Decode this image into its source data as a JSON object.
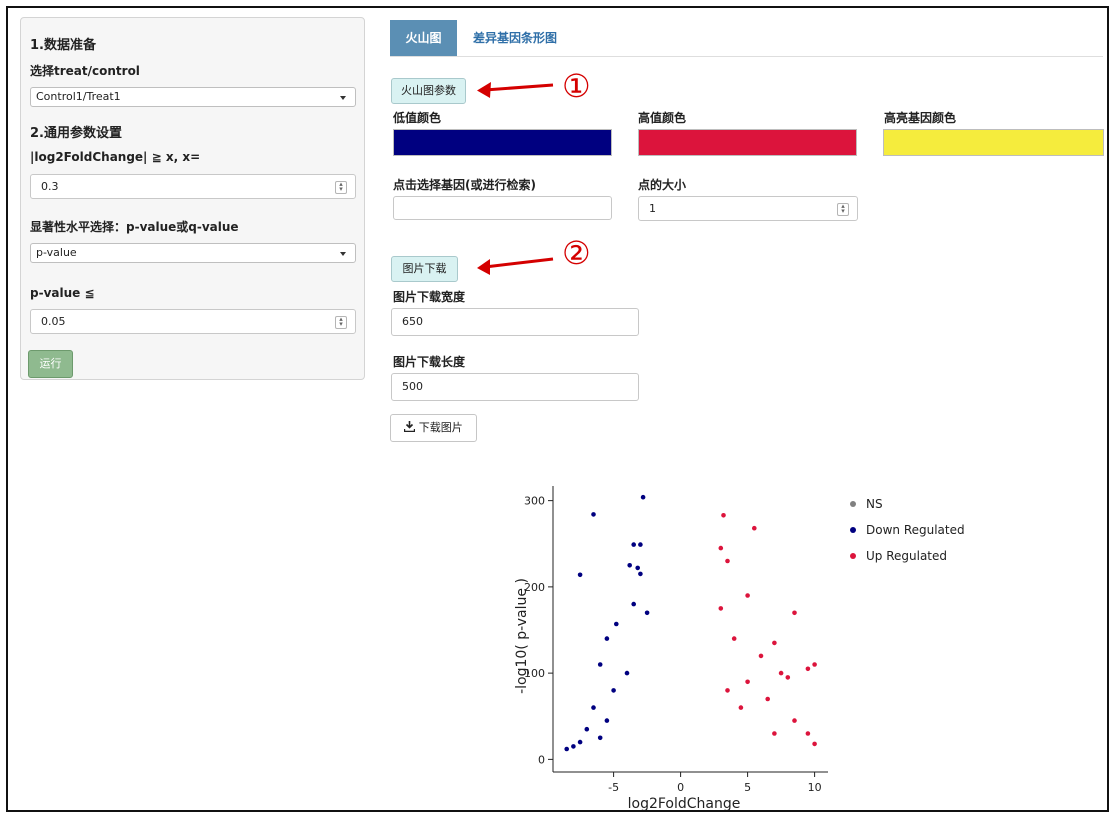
{
  "sidebar": {
    "section1_title": "1.数据准备",
    "treat_label": "选择treat/control",
    "treat_value": "Control1/Treat1",
    "section2_title": "2.通用参数设置",
    "fc_label": "|log2FoldChange| ≧ x, x=",
    "fc_value": "0.3",
    "sig_label": "显著性水平选择：p-value或q-value",
    "sig_value": "p-value",
    "p_label": "p-value ≦",
    "p_value": "0.05",
    "run_label": "运行"
  },
  "tabs": [
    {
      "label": "火山图",
      "active": true
    },
    {
      "label": "差异基因条形图",
      "active": false
    }
  ],
  "params": {
    "button_label": "火山图参数",
    "low_color_label": "低值颜色",
    "high_color_label": "高值颜色",
    "highlight_color_label": "高亮基因颜色",
    "low_color": "#000080",
    "high_color": "#dc143c",
    "highlight_color": "#f5ec3d",
    "gene_select_label": "点击选择基因(或进行检索)",
    "gene_select_value": "",
    "point_size_label": "点的大小",
    "point_size_value": "1"
  },
  "download": {
    "button_label": "图片下载",
    "width_label": "图片下载宽度",
    "width_value": "650",
    "height_label": "图片下载长度",
    "height_value": "500",
    "download_label": "下载图片",
    "download_icon": "download-icon"
  },
  "annotations": {
    "marker1": "①",
    "marker2": "②",
    "arrow_color": "#d40000"
  },
  "chart_data": {
    "type": "scatter",
    "xlabel": "log2FoldChange",
    "ylabel": "-log10( p-value )",
    "xlim": [
      -9,
      11
    ],
    "ylim": [
      -10,
      310
    ],
    "x_ticks": [
      "-5",
      "0",
      "5",
      "10"
    ],
    "y_ticks": [
      "0",
      "100",
      "200",
      "300"
    ],
    "grid": false,
    "legend_position": "right",
    "series": [
      {
        "name": "NS",
        "color": "#808080",
        "points": []
      },
      {
        "name": "Down Regulated",
        "color": "#000080",
        "points": [
          [
            -2.8,
            304
          ],
          [
            -6.5,
            284
          ],
          [
            -3.5,
            249
          ],
          [
            -3.0,
            249
          ],
          [
            -7.5,
            214
          ],
          [
            -3.2,
            222
          ],
          [
            -3.0,
            215
          ],
          [
            -3.8,
            225
          ],
          [
            -4.8,
            157
          ],
          [
            -5.5,
            140
          ],
          [
            -3.5,
            180
          ],
          [
            -2.5,
            170
          ],
          [
            -6.0,
            110
          ],
          [
            -4.0,
            100
          ],
          [
            -5.0,
            80
          ],
          [
            -6.5,
            60
          ],
          [
            -7.0,
            35
          ],
          [
            -8.0,
            15
          ],
          [
            -8.5,
            12
          ],
          [
            -7.5,
            20
          ],
          [
            -6.0,
            25
          ],
          [
            -5.5,
            45
          ]
        ]
      },
      {
        "name": "Up Regulated",
        "color": "#dc143c",
        "points": [
          [
            3.2,
            283
          ],
          [
            5.5,
            268
          ],
          [
            3.0,
            245
          ],
          [
            3.5,
            230
          ],
          [
            3.0,
            175
          ],
          [
            5.0,
            190
          ],
          [
            8.5,
            170
          ],
          [
            7.0,
            135
          ],
          [
            4.0,
            140
          ],
          [
            6.0,
            120
          ],
          [
            10.0,
            110
          ],
          [
            9.5,
            105
          ],
          [
            7.5,
            100
          ],
          [
            8.0,
            95
          ],
          [
            5.0,
            90
          ],
          [
            6.5,
            70
          ],
          [
            8.5,
            45
          ],
          [
            9.5,
            30
          ],
          [
            10.0,
            18
          ],
          [
            7.0,
            30
          ],
          [
            4.5,
            60
          ],
          [
            3.5,
            80
          ]
        ]
      }
    ]
  }
}
